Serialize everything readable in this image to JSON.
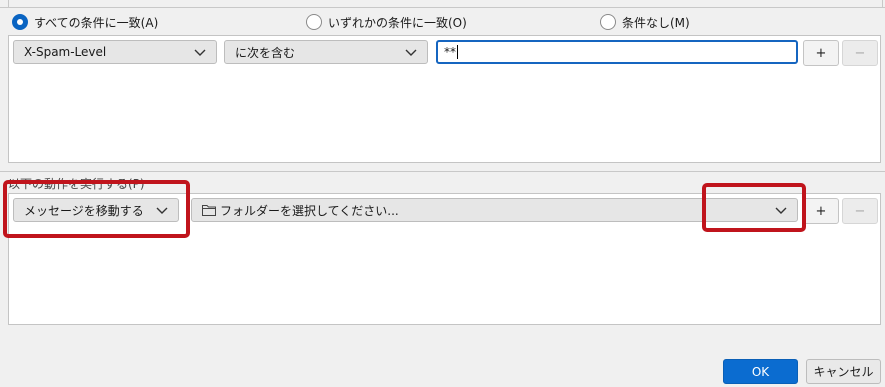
{
  "match_options": [
    {
      "label": "すべての条件に一致(A)",
      "checked": true
    },
    {
      "label": "いずれかの条件に一致(O)",
      "checked": false
    },
    {
      "label": "条件なし(M)",
      "checked": false
    }
  ],
  "criteria": {
    "field": "X-Spam-Level",
    "operator": "に次を含む",
    "value": "**",
    "add_label": "+",
    "remove_label": "−"
  },
  "actions": {
    "section_label": "以下の動作を実行する(P)",
    "action_type": "メッセージを移動する",
    "target_folder": "フォルダーを選択してください...",
    "add_label": "+",
    "remove_label": "−"
  },
  "footer": {
    "ok_label": "OK",
    "cancel_label": "キャンセル"
  },
  "colors": {
    "accent": "#0b6cd0",
    "highlight": "#c0141c"
  },
  "icons": {
    "dropdown": "chevron-down-icon",
    "folder": "folder-icon"
  }
}
